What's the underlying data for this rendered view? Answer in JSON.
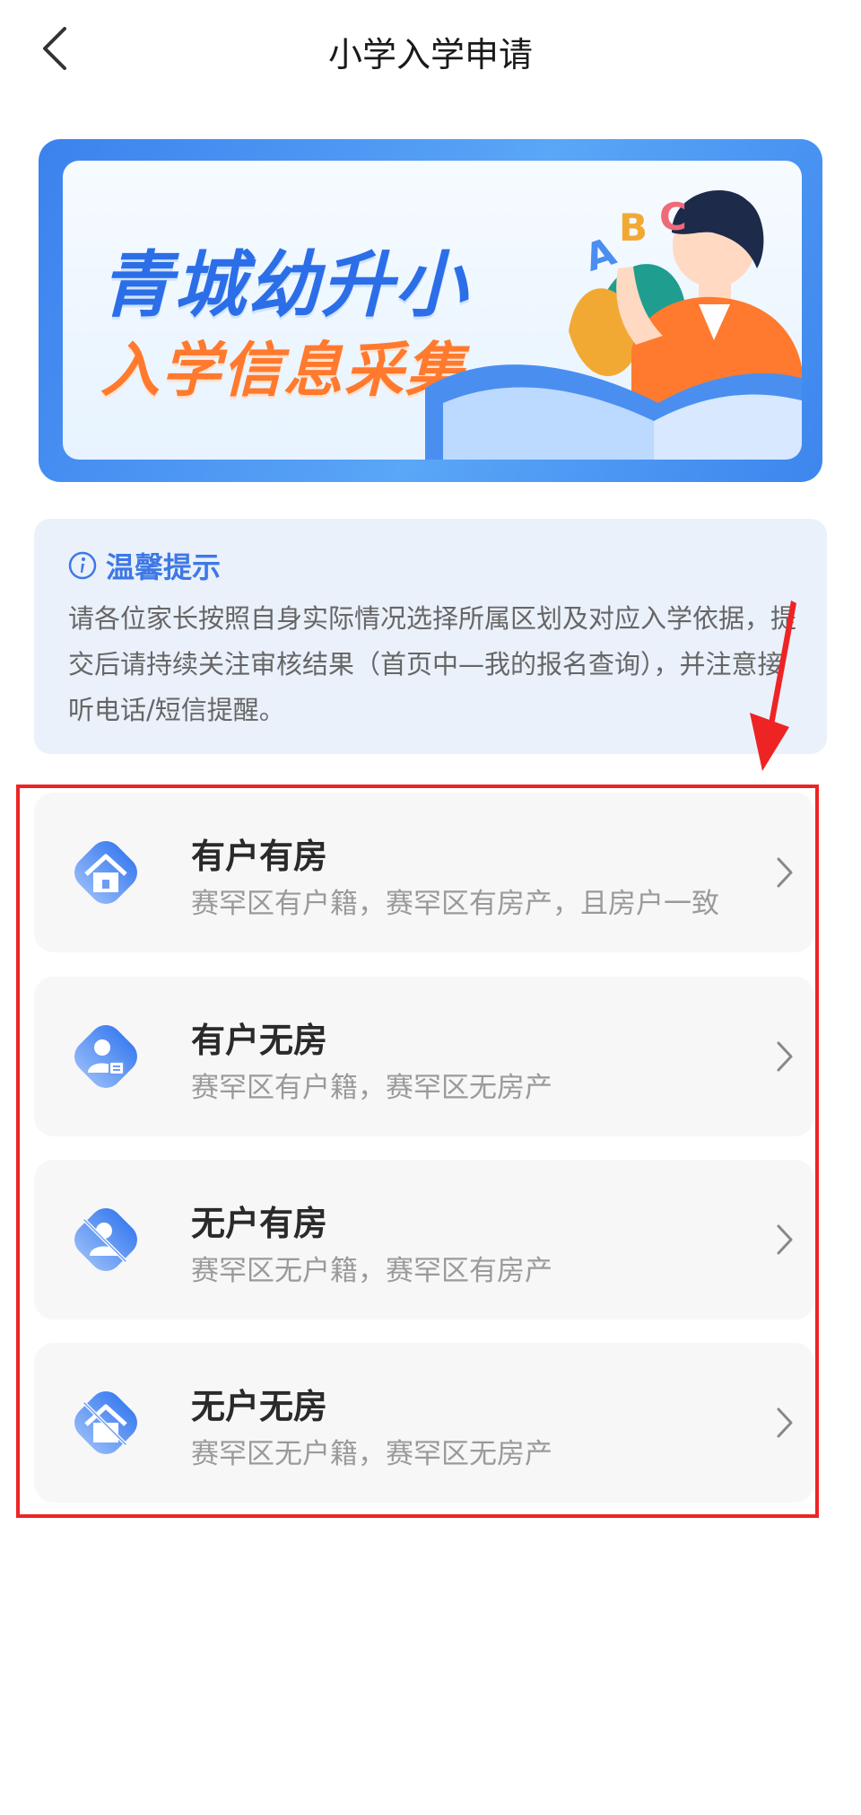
{
  "header": {
    "title": "小学入学申请"
  },
  "banner": {
    "line1": "青城幼升小",
    "line2": "入学信息采集",
    "letters": [
      "A",
      "B",
      "C"
    ]
  },
  "tip": {
    "title": "温馨提示",
    "body": "请各位家长按照自身实际情况选择所属区划及对应入学依据，提交后请持续关注审核结果（首页中—我的报名查询），并注意接听电话/短信提醒。"
  },
  "options": [
    {
      "title": "有户有房",
      "desc": "赛罕区有户籍，赛罕区有房产，且房户一致",
      "icon": "house-icon"
    },
    {
      "title": "有户无房",
      "desc": "赛罕区有户籍，赛罕区无房产",
      "icon": "person-id-icon"
    },
    {
      "title": "无户有房",
      "desc": "赛罕区无户籍，赛罕区有房产",
      "icon": "person-slash-icon"
    },
    {
      "title": "无户无房",
      "desc": "赛罕区无户籍，赛罕区无房产",
      "icon": "house-slash-icon"
    }
  ],
  "colors": {
    "accent": "#3e78e6",
    "orange": "#ff7a2e",
    "highlight": "#ee2424"
  }
}
